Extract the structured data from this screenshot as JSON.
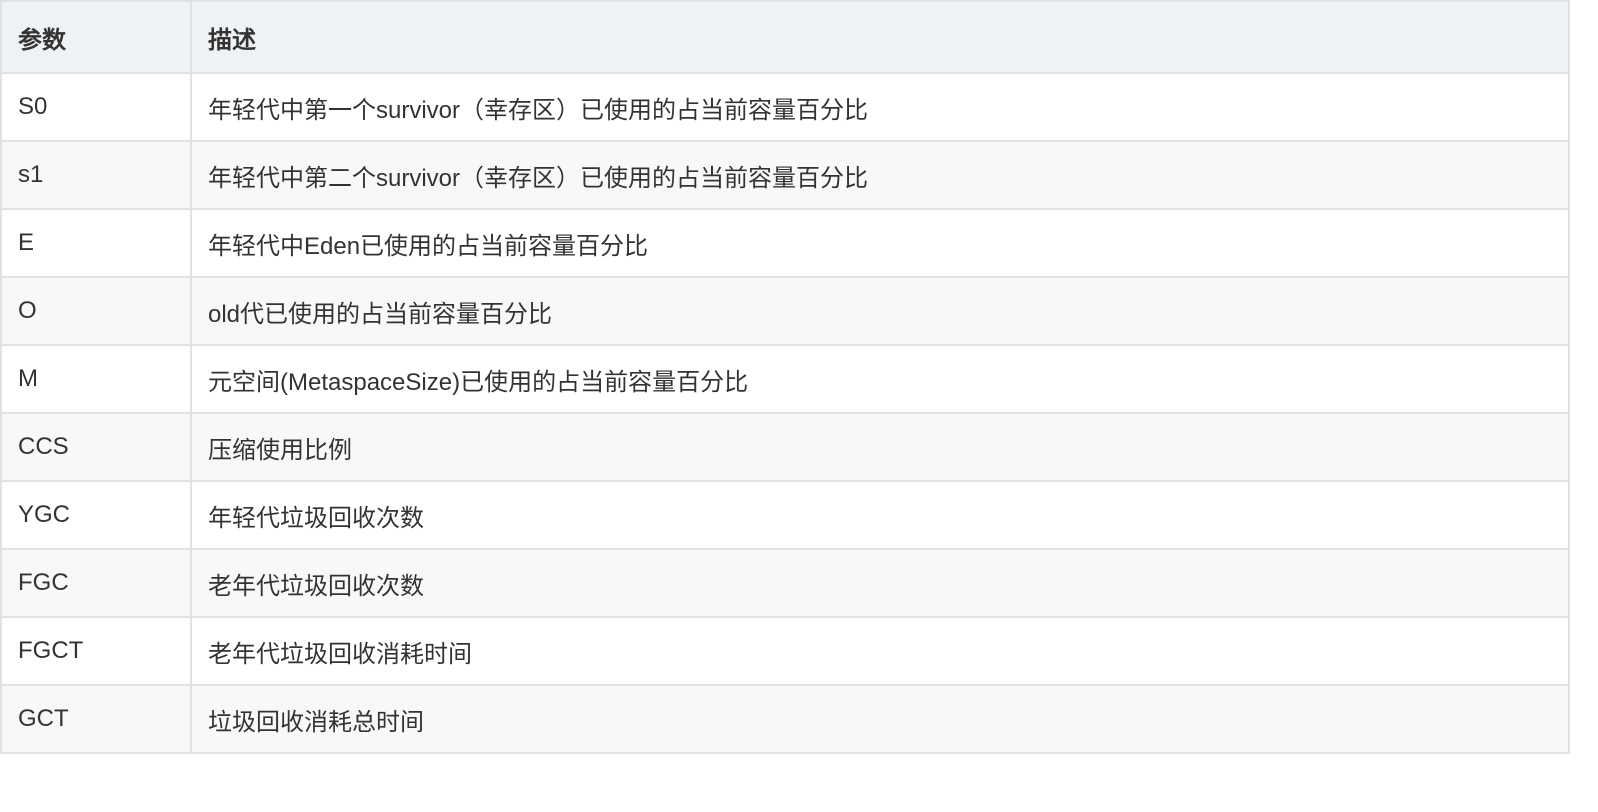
{
  "table": {
    "headers": [
      "参数",
      "描述"
    ],
    "rows": [
      {
        "param": "S0",
        "desc": "年轻代中第一个survivor（幸存区）已使用的占当前容量百分比"
      },
      {
        "param": "s1",
        "desc": "年轻代中第二个survivor（幸存区）已使用的占当前容量百分比"
      },
      {
        "param": "E",
        "desc": "年轻代中Eden已使用的占当前容量百分比"
      },
      {
        "param": "O",
        "desc": "old代已使用的占当前容量百分比"
      },
      {
        "param": "M",
        "desc": "元空间(MetaspaceSize)已使用的占当前容量百分比"
      },
      {
        "param": "CCS",
        "desc": "压缩使用比例"
      },
      {
        "param": "YGC",
        "desc": "年轻代垃圾回收次数"
      },
      {
        "param": "FGC",
        "desc": "老年代垃圾回收次数"
      },
      {
        "param": "FGCT",
        "desc": "老年代垃圾回收消耗时间"
      },
      {
        "param": "GCT",
        "desc": "垃圾回收消耗总时间"
      }
    ]
  },
  "colors": {
    "header_bg": "#eff2f5",
    "border": "#dfe2e5",
    "stripe": "#f8f8f8",
    "text": "#333333"
  }
}
